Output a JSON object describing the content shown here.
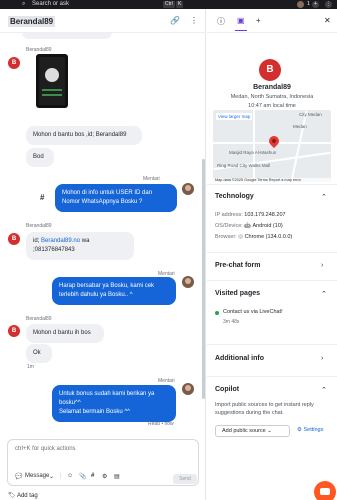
{
  "topbar": {
    "search_placeholder": "Search or ask",
    "shortcut_ctrl": "Ctrl",
    "shortcut_k": "K",
    "badge_count": "1"
  },
  "conversation": {
    "title": "Berandal89"
  },
  "messages": {
    "sender_visitor": "Berandal89",
    "sender_agent": "Mentari",
    "m1": "Mohon d bantu bos ,id; Berandal89",
    "m2": "Bod",
    "m3": "Mohon di info untuk USER ID dan Nomor WhatsAppnya Bosku ?",
    "m4_prefix": "id; ",
    "m4_link": "Berandal89.no",
    "m4_suffix": " wa",
    "m4_line2": ";081376847843",
    "m5": "Harap bersabar ya Bosku, kami cek terlebih dahulu ya Bosku.. ^",
    "m6": "Mohon d bantu ih bos",
    "m7": "Ok",
    "m7_time": "1m",
    "m8_line1": "Untuk bonus sudah kami berikan ya",
    "m8_line2": "bosku^^",
    "m8_line3": "Selamat bermain Bosku ^^",
    "m8_status": "Read • now"
  },
  "composer": {
    "placeholder": "ctrl+K for quick actions",
    "mode_label": "Message",
    "send_label": "Send"
  },
  "add_tag": "Add tag",
  "visitor": {
    "initial": "B",
    "name": "Berandal89",
    "location": "Medan, North Sumatra, Indonesia",
    "local_time": "10:47 am local time"
  },
  "map": {
    "view_larger": "View larger map",
    "labels": [
      "Masjid Raya Al-Mashun",
      "Ring Road City Walks Mall",
      "Medan",
      "City Medan"
    ],
    "attribution": "Map data ©2025 Google   Terms   Report a map error"
  },
  "technology": {
    "title": "Technology",
    "ip_label": "IP address:",
    "ip_value": "103.179.248.207",
    "os_label": "OS/Device:",
    "os_value": "Android (10)",
    "browser_label": "Browser:",
    "browser_value": "Chrome (134.0.0.0)"
  },
  "sections": {
    "prechat": "Pre-chat form",
    "visited": "Visited pages",
    "additional": "Additional info",
    "copilot": "Copilot"
  },
  "visited_pages": [
    {
      "title": "Contact us via LiveChat!",
      "duration": "3m 48s"
    }
  ],
  "copilot": {
    "text": "Import public sources to get instant reply suggestions during the chat.",
    "add_source": "Add public source",
    "settings": "Settings"
  }
}
